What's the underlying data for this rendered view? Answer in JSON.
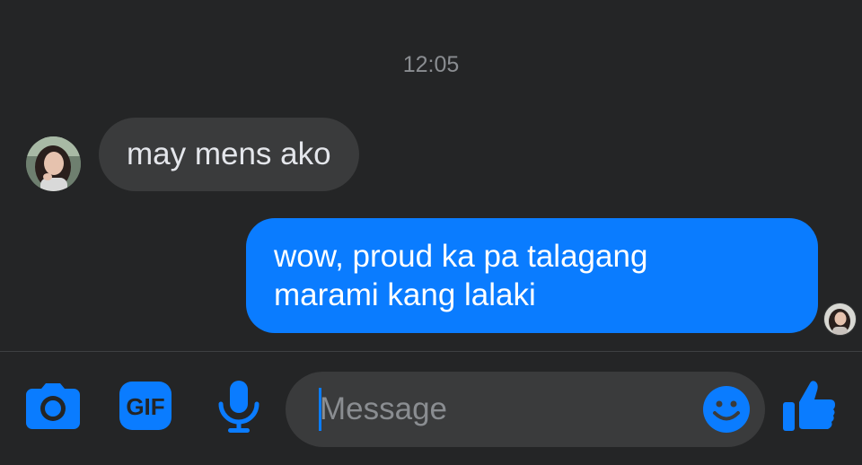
{
  "chat": {
    "timestamp": "12:05",
    "messages": [
      {
        "sender": "them",
        "text": "may mens ako"
      },
      {
        "sender": "me",
        "lines": [
          "wow, proud ka pa talagang",
          "marami kang lalaki"
        ]
      }
    ]
  },
  "composer": {
    "placeholder": "Message",
    "gif_label": "GIF",
    "icons": {
      "camera": "camera-icon",
      "gif": "gif-icon",
      "mic": "microphone-icon",
      "emoji": "emoji-icon",
      "like": "thumbs-up-icon"
    }
  },
  "colors": {
    "background": "#242526",
    "incoming_bubble": "#3a3b3c",
    "outgoing_bubble": "#0a7cff",
    "accent": "#0a7cff"
  }
}
